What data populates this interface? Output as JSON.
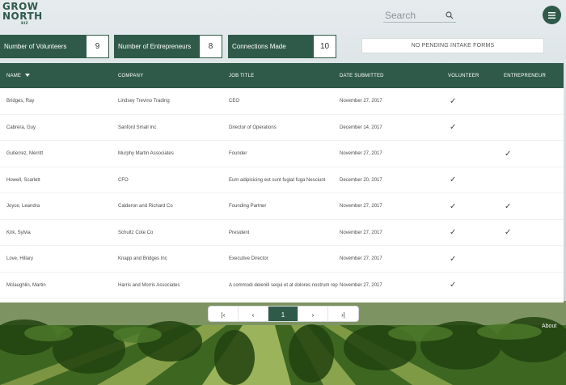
{
  "logo": {
    "line1": "GROW",
    "line2": "NORTH",
    "tag": "BIZ"
  },
  "search": {
    "placeholder": "Search"
  },
  "stats": [
    {
      "label": "Number of Volunteers",
      "value": "9"
    },
    {
      "label": "Number of Entrepreneurs",
      "value": "8"
    },
    {
      "label": "Connections Made",
      "value": "10"
    }
  ],
  "intake": {
    "label": "NO PENDING INTAKE FORMS"
  },
  "table": {
    "headers": {
      "name": "NAME",
      "company": "COMPANY",
      "job_title": "JOB TITLE",
      "date_submitted": "DATE SUBMITTED",
      "volunteer": "VOLUNTEER",
      "entrepreneur": "ENTREPRENEUR"
    },
    "rows": [
      {
        "name": "Bridges, Ray",
        "company": "Lindsey Trevino Trading",
        "job_title": "CEO",
        "date": "November 27, 2017",
        "volunteer": "✓",
        "entrepreneur": ""
      },
      {
        "name": "Cabrera, Guy",
        "company": "Sanford Small Inc",
        "job_title": "Director of Operations",
        "date": "December 14, 2017",
        "volunteer": "✓",
        "entrepreneur": ""
      },
      {
        "name": "Gutierrez, Merritt",
        "company": "Murphy Martin Associates",
        "job_title": "Founder",
        "date": "November 27, 2017",
        "volunteer": "",
        "entrepreneur": "✓"
      },
      {
        "name": "Howell, Scarlett",
        "company": "CFO",
        "job_title": "Eum adipisicing est sunt fugiat fuga Nesciunt",
        "date": "December 20, 2017",
        "volunteer": "✓",
        "entrepreneur": ""
      },
      {
        "name": "Joyce, Leandra",
        "company": "Calderon and Richard Co",
        "job_title": "Founding Partner",
        "date": "November 27, 2017",
        "volunteer": "✓",
        "entrepreneur": "✓"
      },
      {
        "name": "Kirk, Sylvia",
        "company": "Schultz Cote Co",
        "job_title": "President",
        "date": "November 27, 2017",
        "volunteer": "✓",
        "entrepreneur": "✓"
      },
      {
        "name": "Love, Hillary",
        "company": "Knapp and Bridges Inc",
        "job_title": "Executive Director",
        "date": "November 27, 2017",
        "volunteer": "✓",
        "entrepreneur": ""
      },
      {
        "name": "Mclaughlin, Martin",
        "company": "Harris and Morris Associates",
        "job_title": "A commodi deleniti sequi et at dolores nostrum rep",
        "date": "November 27, 2017",
        "volunteer": "✓",
        "entrepreneur": ""
      }
    ]
  },
  "pagination": {
    "first": "|‹",
    "prev": "‹",
    "current": "1",
    "next": "›",
    "last": "›|"
  },
  "footer": {
    "about": "About"
  },
  "colors": {
    "brand": "#2f5a4a"
  }
}
